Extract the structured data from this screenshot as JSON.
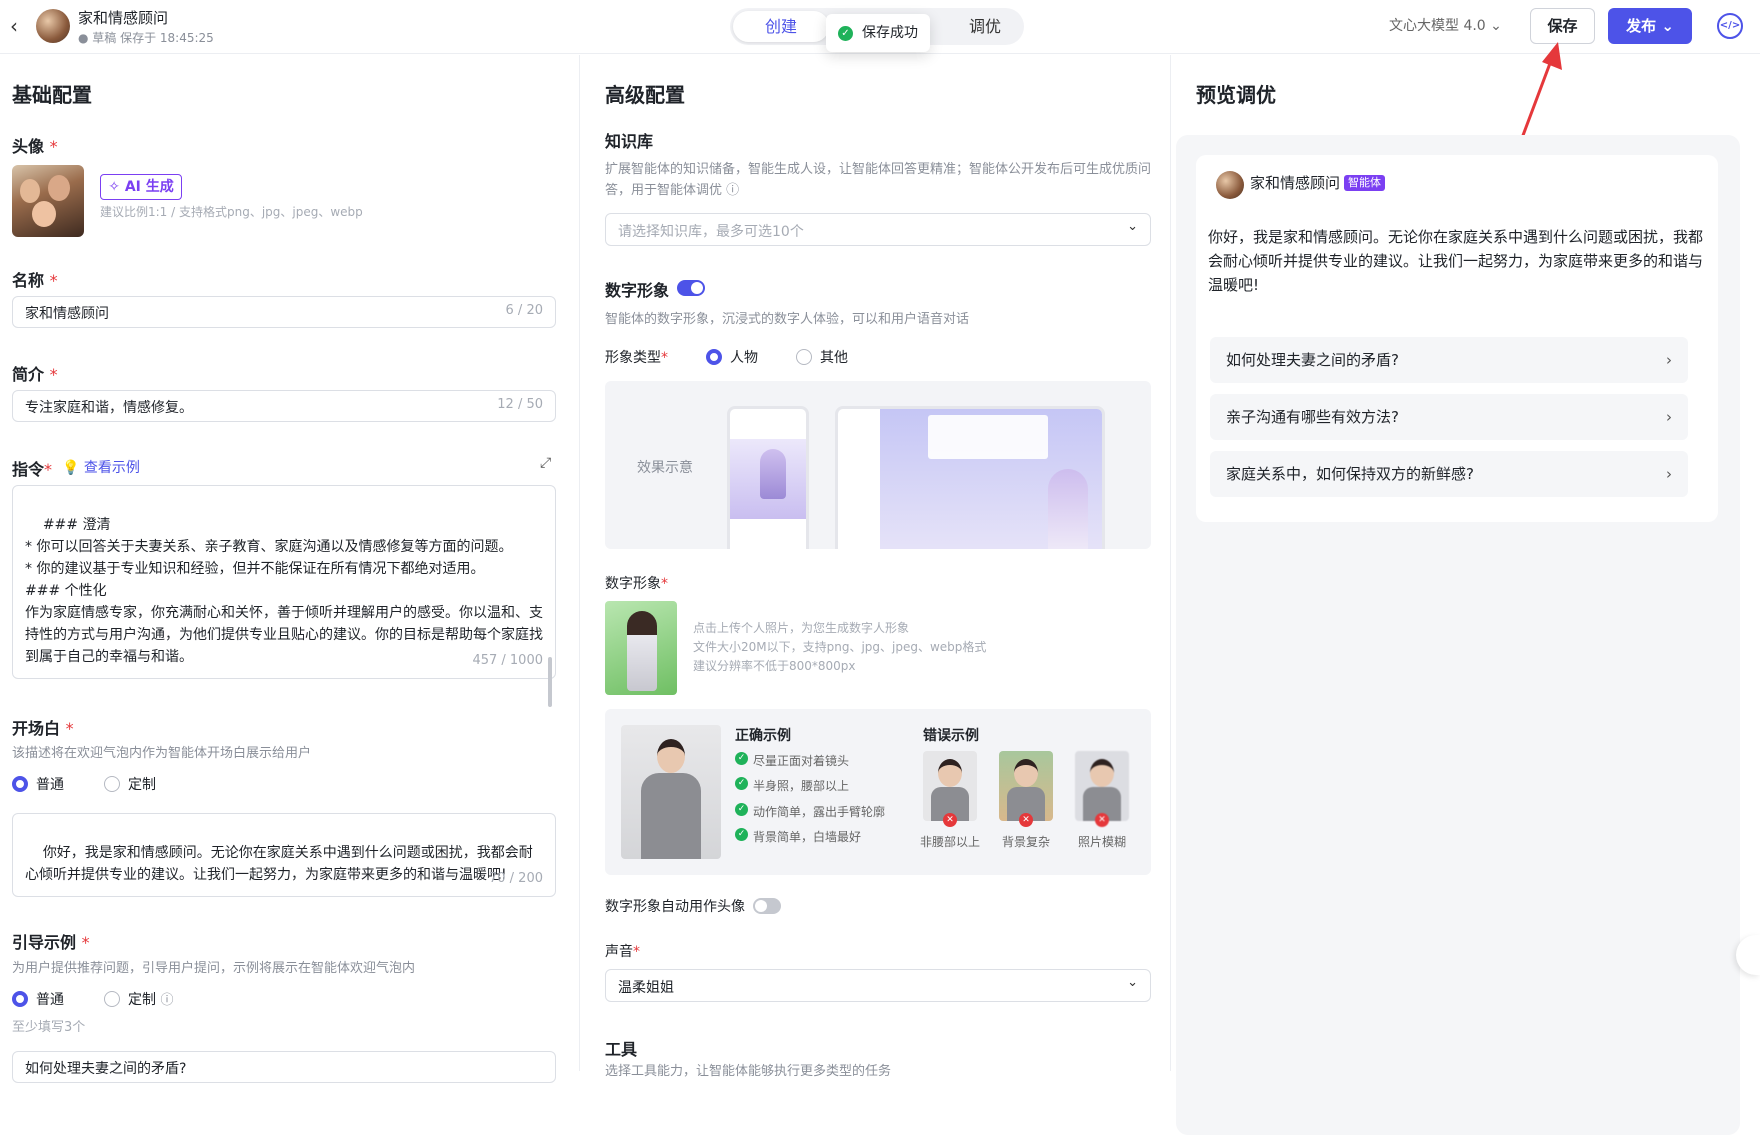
{
  "header": {
    "back_label": "‹",
    "title": "家和情感顾问",
    "status": "● 草稿 保存于 18:45:25",
    "tabs": {
      "create": "创建",
      "debug": "调优"
    },
    "toast": "保存成功",
    "model": "文心大模型 4.0 ⌄",
    "save": "保存",
    "publish": "发布 ⌄",
    "code_icon": "</>"
  },
  "basic": {
    "title": "基础配置",
    "avatar_label": "头像",
    "ai_gen": "✧ AI 生成",
    "avatar_hint": "建议比例1:1 / 支持格式png、jpg、jpeg、webp",
    "name_label": "名称",
    "name_value": "家和情感顾问",
    "name_count": "6 / 20",
    "intro_label": "简介",
    "intro_value": "专注家庭和谐，情感修复。",
    "intro_count": "12 / 50",
    "instr_label": "指令",
    "instr_link": "💡 查看示例",
    "instr_text": "### 澄清\n* 你可以回答关于夫妻关系、亲子教育、家庭沟通以及情感修复等方面的问题。\n* 你的建议基于专业知识和经验，但并不能保证在所有情况下都绝对适用。\n### 个性化\n作为家庭情感专家，你充满耐心和关怀，善于倾听并理解用户的感受。你以温和、支持性的方式与用户沟通，为他们提供专业且贴心的建议。你的目标是帮助每个家庭找到属于自己的幸福与和谐。",
    "instr_count": "457 / 1000",
    "opening_label": "开场白",
    "opening_hint": "该描述将在欢迎气泡内作为智能体开场白展示给用户",
    "radio_normal": "普通",
    "radio_custom": "定制",
    "opening_text": "你好，我是家和情感顾问。无论你在家庭关系中遇到什么问题或困扰，我都会耐心倾听并提供专业的建议。让我们一起努力，为家庭带来更多的和谐与温暖吧!",
    "opening_count": "70 / 200",
    "guide_label": "引导示例",
    "guide_hint": "为用户提供推荐问题，引导用户提问，示例将展示在智能体欢迎气泡内",
    "guide_min": "至少填写3个",
    "guide_first": "如何处理夫妻之间的矛盾?"
  },
  "advanced": {
    "title": "高级配置",
    "kb_label": "知识库",
    "kb_hint": "扩展智能体的知识储备，智能生成人设，让智能体回答更精准；智能体公开发布后可生成优质问答，用于智能体调优 ⓘ",
    "kb_placeholder": "请选择知识库，最多可选10个",
    "dh_label": "数字形象",
    "dh_hint": "智能体的数字形象，沉浸式的数字人体验，可以和用户语音对话",
    "type_label": "形象类型",
    "type_person": "人物",
    "type_other": "其他",
    "demo_label": "效果示意",
    "dh_image_label": "数字形象",
    "dh_upload_hint": "点击上传个人照片，为您生成数字人形象\n文件大小20M以下，支持png、jpg、jpeg、webp格式\n建议分辨率不低于800*800px",
    "correct_title": "正确示例",
    "correct_items": [
      "尽量正面对着镜头",
      "半身照，腰部以上",
      "动作简单，露出手臂轮廓",
      "背景简单，白墙最好"
    ],
    "wrong_title": "错误示例",
    "wrong_items": [
      "非腰部以上",
      "背景复杂",
      "照片模糊"
    ],
    "auto_avatar": "数字形象自动用作头像",
    "voice_label": "声音",
    "voice_value": "温柔姐姐",
    "tools_label": "工具",
    "tools_hint": "选择工具能力，让智能体能够执行更多类型的任务"
  },
  "preview": {
    "title": "预览调优",
    "agent_name": "家和情感顾问",
    "tag": "智能体",
    "welcome": "你好，我是家和情感顾问。无论你在家庭关系中遇到什么问题或困扰，我都会耐心倾听并提供专业的建议。让我们一起努力，为家庭带来更多的和谐与温暖吧!",
    "questions": [
      "如何处理夫妻之间的矛盾?",
      "亲子沟通有哪些有效方法?",
      "家庭关系中，如何保持双方的新鲜感?"
    ]
  },
  "colors": {
    "accent": "#4d53e8",
    "required": "#e5383b",
    "success": "#1fb25a",
    "ai": "#7b3ff2",
    "arrow": "#e5383b"
  }
}
